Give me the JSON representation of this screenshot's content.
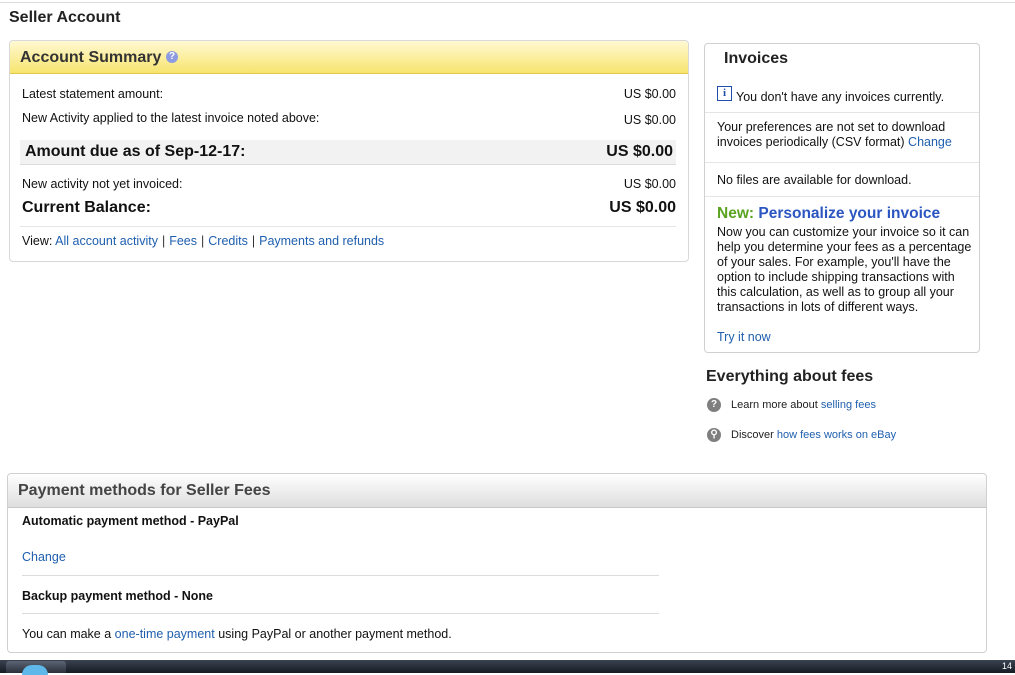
{
  "page": {
    "title": "Seller Account"
  },
  "summary": {
    "title": "Account Summary",
    "help_icon": "question-icon",
    "rows": [
      {
        "label": "Latest statement amount:",
        "value": "US $0.00"
      },
      {
        "label": "New Activity applied to the latest invoice noted above:",
        "value": "US $0.00"
      }
    ],
    "due": {
      "label": "Amount due as of Sep-12-17:",
      "value": "US $0.00"
    },
    "not_invoiced": {
      "label": "New activity not yet invoiced:",
      "value": "US $0.00"
    },
    "balance": {
      "label": "Current Balance:",
      "value": "US $0.00"
    },
    "view_label": "View:",
    "view_links": [
      "All account activity",
      "Fees",
      "Credits",
      "Payments and refunds"
    ]
  },
  "invoices": {
    "title": "Invoices",
    "info_icon": "info-icon",
    "no_invoices": "You don't have any invoices currently.",
    "prefs_text": "Your preferences are not set to download invoices periodically (CSV format)",
    "prefs_link": "Change",
    "no_files": "No files are available for download.",
    "new_label": "New:",
    "new_title": "Personalize your invoice",
    "new_body": "Now you can customize your invoice so it can help you determine your fees as a percentage of your sales. For example, you'll have the option to include shipping transactions with this calculation, as well as to group all your transactions in lots of different ways.",
    "try_link": "Try it now"
  },
  "fees": {
    "title": "Everything about fees",
    "items": [
      {
        "icon": "question-icon",
        "text": "Learn more about",
        "link": "selling fees"
      },
      {
        "icon": "search-icon",
        "text": "Discover",
        "link": "how fees works on eBay"
      }
    ]
  },
  "payments": {
    "title": "Payment methods for Seller Fees",
    "automatic": "Automatic payment method - PayPal",
    "change_link": "Change",
    "backup": "Backup payment method - None",
    "onetime_pre": "You can make a",
    "onetime_link": "one-time payment",
    "onetime_post": "using PayPal or another payment method."
  },
  "taskbar": {
    "clock": "14"
  },
  "colors": {
    "summary_header": "#f7e46e",
    "link": "#1f5fae",
    "new_green": "#5aa320",
    "personalize_blue": "#2b55c0"
  }
}
